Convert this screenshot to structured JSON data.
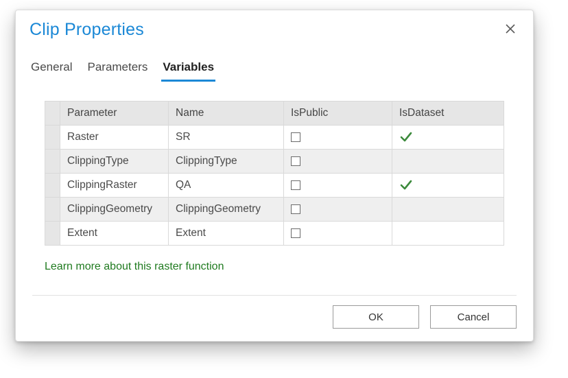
{
  "window": {
    "title": "Clip Properties"
  },
  "tabs": [
    {
      "label": "General",
      "active": false
    },
    {
      "label": "Parameters",
      "active": false
    },
    {
      "label": "Variables",
      "active": true
    }
  ],
  "table": {
    "headers": {
      "parameter": "Parameter",
      "name": "Name",
      "ispublic": "IsPublic",
      "isdataset": "IsDataset"
    },
    "rows": [
      {
        "parameter": "Raster",
        "name": "SR",
        "ispublic": false,
        "isdataset": true
      },
      {
        "parameter": "ClippingType",
        "name": "ClippingType",
        "ispublic": false,
        "isdataset": false
      },
      {
        "parameter": "ClippingRaster",
        "name": "QA",
        "ispublic": false,
        "isdataset": true
      },
      {
        "parameter": "ClippingGeometry",
        "name": "ClippingGeometry",
        "ispublic": false,
        "isdataset": false
      },
      {
        "parameter": "Extent",
        "name": "Extent",
        "ispublic": false,
        "isdataset": false
      }
    ]
  },
  "link": {
    "learn_more": "Learn more about this raster function"
  },
  "buttons": {
    "ok": "OK",
    "cancel": "Cancel"
  }
}
